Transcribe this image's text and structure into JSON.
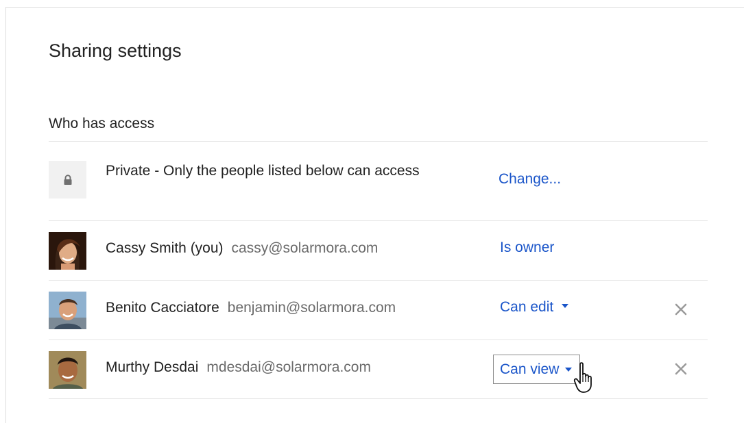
{
  "dialog": {
    "title": "Sharing settings",
    "section_label": "Who has access"
  },
  "access": {
    "icon": "lock-icon",
    "description": "Private - Only the people listed below can access",
    "change_label": "Change..."
  },
  "people": [
    {
      "name": "Cassy Smith (you)",
      "email": "cassy@solarmora.com",
      "permission": "Is owner"
    },
    {
      "name": "Benito Cacciatore",
      "email": "benjamin@solarmora.com",
      "permission": "Can edit"
    },
    {
      "name": "Murthy Desdai",
      "email": "mdesdai@solarmora.com",
      "permission": "Can view"
    }
  ],
  "colors": {
    "link": "#1a55c9",
    "email": "#6a6a6a",
    "divider": "#e5e5e5",
    "remove_icon": "#9a9a9a"
  }
}
